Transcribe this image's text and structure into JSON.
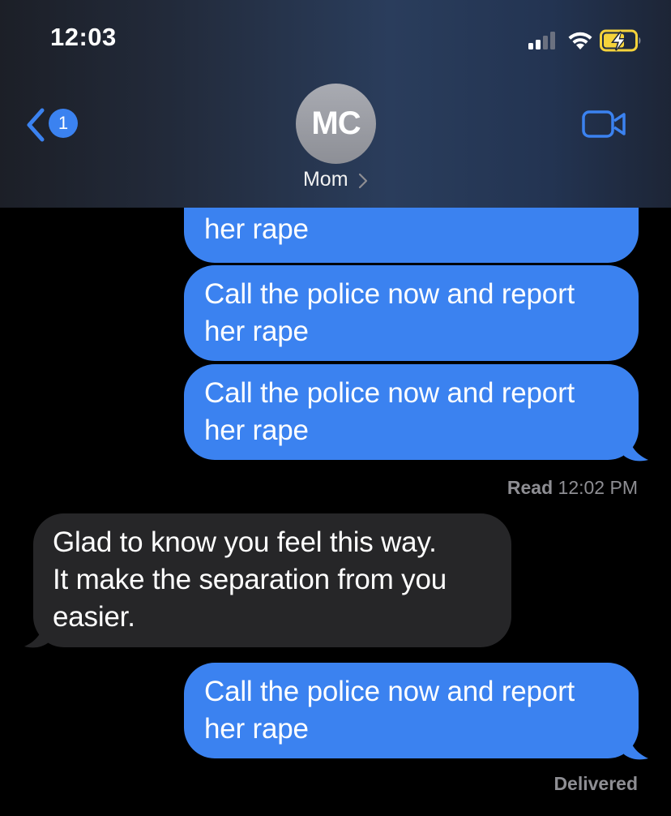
{
  "status_bar": {
    "time": "12:03",
    "icons": [
      "cellular-signal-icon",
      "wifi-icon",
      "battery-charging-icon"
    ]
  },
  "header": {
    "back_badge_count": "1",
    "avatar_initials": "MC",
    "contact_name": "Mom",
    "video_icon": "video-camera-icon"
  },
  "colors": {
    "outgoing_bubble": "#3b82f0",
    "incoming_bubble": "#262628",
    "accent": "#3b82f0",
    "battery_charge": "#f5d33b"
  },
  "messages": [
    {
      "direction": "outgoing",
      "text": "her rape",
      "partially_hidden": true
    },
    {
      "direction": "outgoing",
      "line1": "Call the police now and report",
      "line2": "her rape"
    },
    {
      "direction": "outgoing",
      "line1": "Call the police now and report",
      "line2": "her rape"
    },
    {
      "direction": "incoming",
      "line1": "Glad to know you feel this way.",
      "line2": "It make the separation from you",
      "line3": "easier."
    },
    {
      "direction": "outgoing",
      "line1": "Call the police now and report",
      "line2": "her rape"
    }
  ],
  "receipts": {
    "read_label": "Read",
    "read_time": "12:02 PM",
    "delivered": "Delivered"
  }
}
